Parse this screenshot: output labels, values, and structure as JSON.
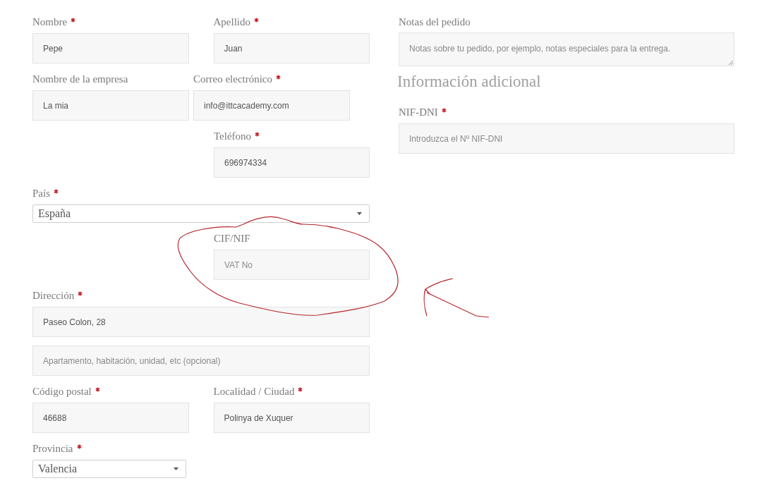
{
  "billing": {
    "fields": [
      {
        "kind": "text",
        "label": "Nombre",
        "required": true,
        "value": "Pepe"
      },
      {
        "kind": "text",
        "label": "Apellido",
        "required": true,
        "value": "Juan"
      },
      {
        "kind": "text",
        "label": "Nombre de la empresa",
        "value": "La mia"
      },
      {
        "kind": "text",
        "label": "Correo electrónico",
        "required": true,
        "value": "info@ittcacademy.com"
      },
      {
        "kind": "text",
        "label": "Teléfono",
        "required": true,
        "value": "696974334"
      },
      {
        "kind": "select",
        "label": "País",
        "required": true,
        "value": "España"
      },
      {
        "kind": "text",
        "label": "CIF/NIF",
        "placeholder": "VAT No"
      },
      {
        "kind": "text",
        "label": "Dirección",
        "required": true,
        "value": "Paseo Colon, 28"
      },
      {
        "kind": "text",
        "placeholder": "Apartamento, habitación, unidad, etc (opcional)"
      },
      {
        "kind": "text",
        "label": "Código postal",
        "required": true,
        "value": "46688"
      },
      {
        "kind": "text",
        "label": "Localidad / Ciudad",
        "required": true,
        "value": "Polinya de Xuquer"
      },
      {
        "kind": "select",
        "label": "Provincia",
        "required": true,
        "value": "Valencia"
      }
    ]
  },
  "order_notes": {
    "label": "Notas del pedido",
    "placeholder": "Notas sobre tu pedido, por ejemplo, notas especiales para la entrega."
  },
  "additional_info": {
    "heading": "Información adicional",
    "fields": [
      {
        "kind": "text",
        "label": "NIF-DNI",
        "required": true,
        "placeholder": "Introduzca el Nº NIF-DNI"
      }
    ]
  }
}
